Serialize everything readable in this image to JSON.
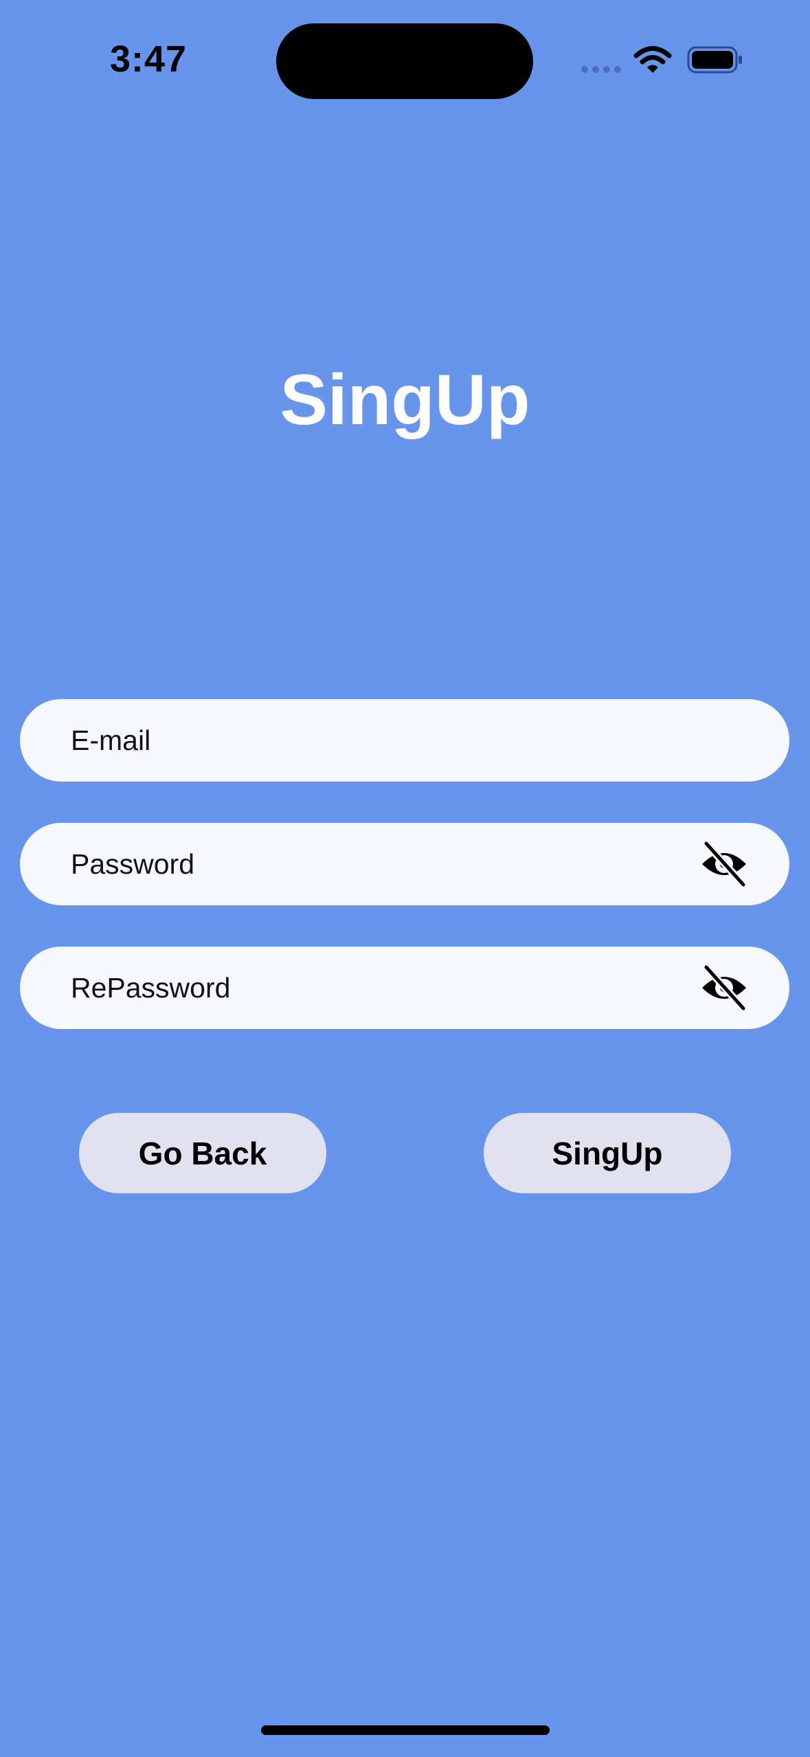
{
  "status_bar": {
    "time": "3:47",
    "icons": [
      "signal-dots-icon",
      "wifi-icon",
      "battery-icon"
    ]
  },
  "page": {
    "title": "SingUp"
  },
  "form": {
    "email_placeholder": "E-mail",
    "password_placeholder": "Password",
    "repassword_placeholder": "RePassword",
    "password_toggle_icon": "eye-slash-icon",
    "repassword_toggle_icon": "eye-slash-icon"
  },
  "buttons": {
    "go_back_label": "Go Back",
    "signup_label": "SingUp"
  },
  "colors": {
    "background": "#6695EB",
    "field_bg": "#F7F8FD",
    "button_bg": "#E1E1EF",
    "title": "#FFFFFF"
  }
}
